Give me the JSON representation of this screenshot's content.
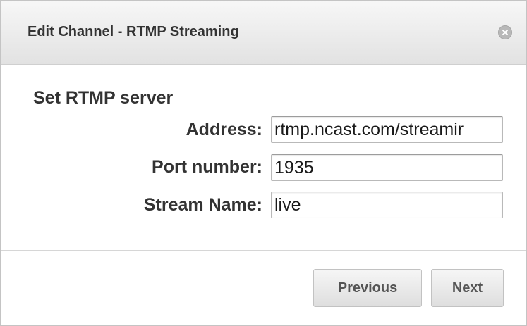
{
  "dialog": {
    "title": "Edit Channel - RTMP Streaming",
    "close_icon": "close-circle-icon"
  },
  "form": {
    "heading": "Set RTMP server",
    "fields": [
      {
        "label": "Address:",
        "value": "rtmp.ncast.com/streamir"
      },
      {
        "label": "Port number:",
        "value": "1935"
      },
      {
        "label": "Stream Name:",
        "value": "live"
      }
    ]
  },
  "footer": {
    "previous_label": "Previous",
    "next_label": "Next"
  },
  "colors": {
    "titlebar_top": "#f7f7f7",
    "titlebar_bottom": "#e2e2e2",
    "text": "#333333",
    "button_text": "#555555"
  }
}
